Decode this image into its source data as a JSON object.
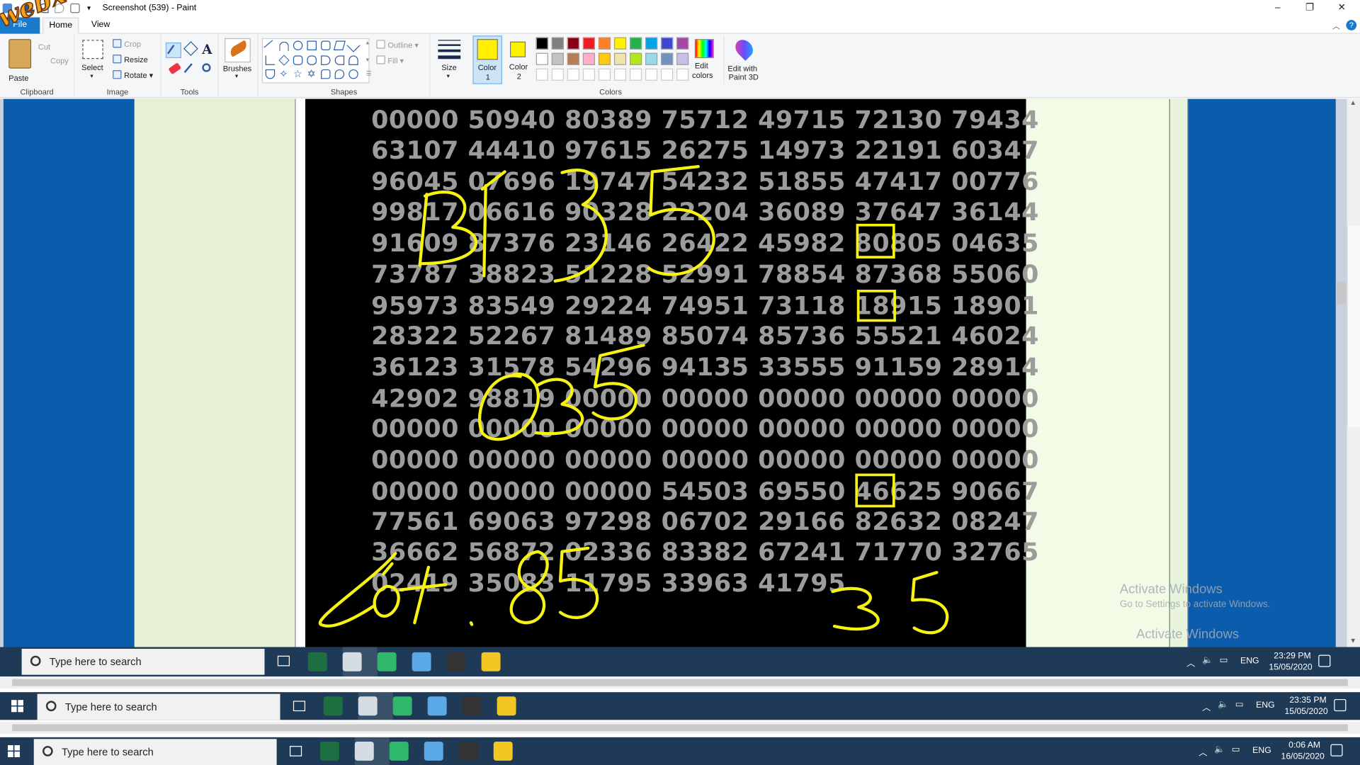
{
  "window": {
    "title": "Screenshot (539) - Paint",
    "min": "–",
    "max": "❐",
    "close": "✕",
    "help": "?"
  },
  "watermark": "webxoso.net",
  "tabs": {
    "file": "File",
    "home": "Home",
    "view": "View"
  },
  "ribbon": {
    "clipboard": {
      "label": "Clipboard",
      "paste": "Paste",
      "cut": "Cut",
      "copy": "Copy"
    },
    "image": {
      "label": "Image",
      "select": "Select",
      "crop": "Crop",
      "resize": "Resize",
      "rotate": "Rotate"
    },
    "tools": {
      "label": "Tools"
    },
    "brushes": {
      "label": "Brushes"
    },
    "shapes": {
      "label": "Shapes",
      "outline": "Outline",
      "fill": "Fill"
    },
    "size": {
      "label": "Size"
    },
    "color1": {
      "label1": "Color",
      "label2": "1",
      "value": "#ffef00"
    },
    "color2": {
      "label1": "Color",
      "label2": "2",
      "value": "#fff200"
    },
    "colors": {
      "label": "Colors",
      "palette": [
        "#000000",
        "#7f7f7f",
        "#880015",
        "#ed1c24",
        "#ff7f27",
        "#fff200",
        "#22b14c",
        "#00a2e8",
        "#3f48cc",
        "#a349a4",
        "#ffffff",
        "#c3c3c3",
        "#b97a57",
        "#ffaec9",
        "#ffc90e",
        "#efe4b0",
        "#b5e61d",
        "#99d9ea",
        "#7092be",
        "#c8bfe7"
      ]
    },
    "edit_colors": {
      "l1": "Edit",
      "l2": "colors"
    },
    "edit_3d": {
      "l1": "Edit with",
      "l2": "Paint 3D"
    }
  },
  "numbers": [
    "00000 50940 80389 75712 49715 72130 79434",
    "63107 44410 97615 26275 14973 22191 60347",
    "96045 07696 19747 54232 51855 47417 00776",
    "99817 06616 90328 22204 36089 37647 36144",
    "91609 87376 23146 26422 45982 80805 04635",
    "73787 38823 51228 52991 78854 87368 55060",
    "95973 83549 29224 74951 73118 18915 18901",
    "28322 52267 81489 85074 85736 55521 46024",
    "36123 31578 54296 94135 33555 91159 28914",
    "42902 98819 00000 00000 00000 00000 00000",
    "00000 00000 00000 00000 00000 00000 00000",
    "00000 00000 00000 00000 00000 00000 00000",
    "00000 00000 00000 54503 69550 46625 90667",
    "77561 69063 97298 06702 29166 82632 08247",
    "36662 56872 02336 83382 67241 71770 32765",
    "02419 35083 11795 33963 41795"
  ],
  "activate": {
    "title": "Activate Windows",
    "sub": "Go to Settings to activate Windows."
  },
  "taskbars": [
    {
      "search": "Type here to search",
      "time": "23:29 PM",
      "date": "15/05/2020",
      "lang": "ENG"
    },
    {
      "search": "Type here to search",
      "time": "23:35 PM",
      "date": "15/05/2020",
      "lang": "ENG"
    },
    {
      "search": "Type here to search",
      "time": "0:06 AM",
      "date": "16/05/2020",
      "lang": "ENG"
    }
  ],
  "colors": {
    "accent": "#1979ca",
    "ink": "#f6f313",
    "taskbar": "#1f3a56",
    "blue_bar": "#0b5cad"
  }
}
